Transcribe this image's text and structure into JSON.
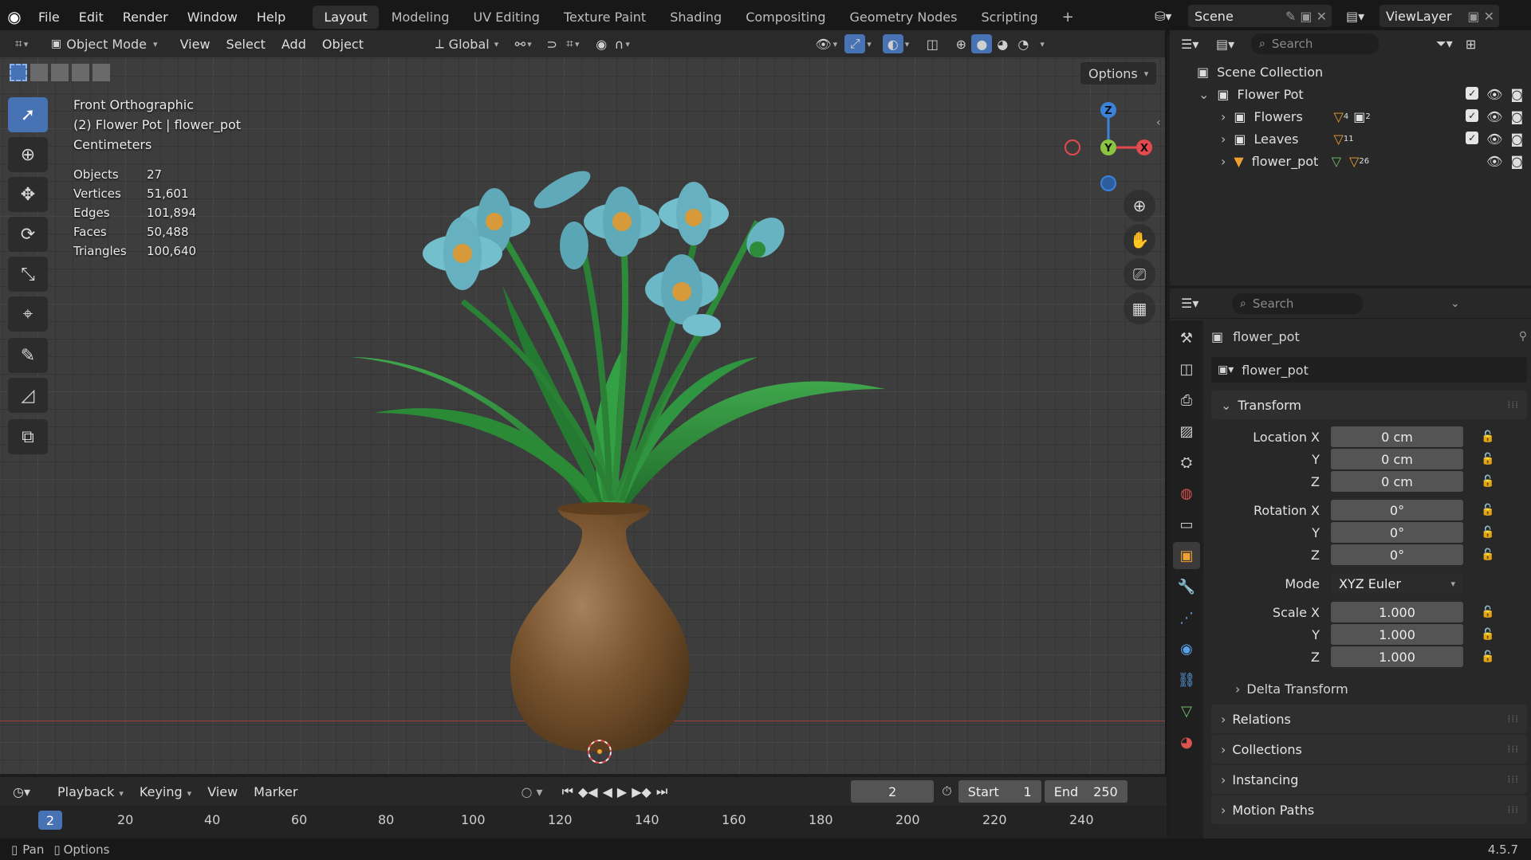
{
  "menu": {
    "items": [
      "File",
      "Edit",
      "Render",
      "Window",
      "Help"
    ]
  },
  "workspaces": [
    "Layout",
    "Modeling",
    "UV Editing",
    "Texture Paint",
    "Shading",
    "Compositing",
    "Geometry Nodes",
    "Scripting"
  ],
  "active_workspace": "Layout",
  "scene": {
    "name": "Scene",
    "view_layer": "ViewLayer"
  },
  "viewport_header": {
    "mode": "Object Mode",
    "menus": [
      "View",
      "Select",
      "Add",
      "Object"
    ],
    "transform_orientation": "Global",
    "options_label": "Options"
  },
  "viewport_overlay": {
    "view_name": "Front Orthographic",
    "object_line": "(2) Flower Pot | flower_pot",
    "units": "Centimeters",
    "stats": [
      {
        "label": "Objects",
        "value": "27"
      },
      {
        "label": "Vertices",
        "value": "51,601"
      },
      {
        "label": "Edges",
        "value": "101,894"
      },
      {
        "label": "Faces",
        "value": "50,488"
      },
      {
        "label": "Triangles",
        "value": "100,640"
      }
    ]
  },
  "gizmo": {
    "z": "Z",
    "y": "Y",
    "x": "X"
  },
  "outliner": {
    "search_placeholder": "Search",
    "root": "Scene Collection",
    "collection": "Flower Pot",
    "children": [
      {
        "name": "Flowers",
        "badge": "4",
        "badge2": "2"
      },
      {
        "name": "Leaves",
        "badge": "11"
      },
      {
        "name": "flower_pot",
        "badge": "26"
      }
    ]
  },
  "properties": {
    "search_placeholder": "Search",
    "object_name": "flower_pot",
    "datablock_name": "flower_pot",
    "transform_label": "Transform",
    "location_label": "Location X",
    "rotation_label": "Rotation X",
    "scale_label": "Scale X",
    "y_label": "Y",
    "z_label": "Z",
    "location": [
      "0 cm",
      "0 cm",
      "0 cm"
    ],
    "rotation": [
      "0°",
      "0°",
      "0°"
    ],
    "mode_label": "Mode",
    "mode_value": "XYZ Euler",
    "scale": [
      "1.000",
      "1.000",
      "1.000"
    ],
    "sub_panels": [
      "Delta Transform"
    ],
    "panels": [
      "Relations",
      "Collections",
      "Instancing",
      "Motion Paths"
    ]
  },
  "timeline": {
    "menus": [
      "Playback",
      "Keying",
      "View",
      "Marker"
    ],
    "current_frame": "2",
    "start_label": "Start",
    "start_value": "1",
    "end_label": "End",
    "end_value": "250",
    "ruler": [
      "20",
      "40",
      "60",
      "80",
      "100",
      "120",
      "140",
      "160",
      "180",
      "200",
      "220",
      "240"
    ],
    "playhead": "2"
  },
  "statusbar": {
    "pan": "Pan",
    "options": "Options",
    "version": "4.5.7"
  },
  "colors": {
    "accent": "#4772b3",
    "x_axis": "#e5484d",
    "y_axis": "#8bc540",
    "z_axis": "#3b82d9",
    "vase": "#7a5530",
    "leaf": "#2e8b3a",
    "petal": "#6cb8c6"
  }
}
